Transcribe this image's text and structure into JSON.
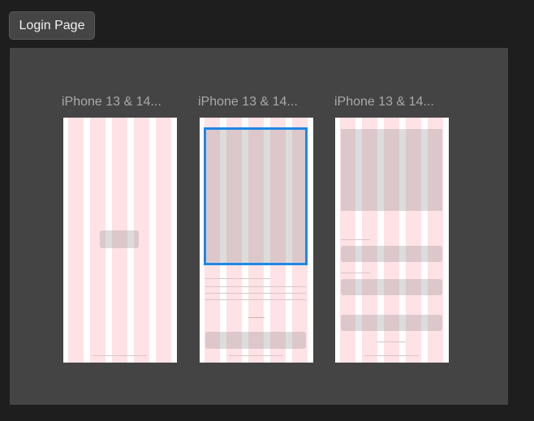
{
  "section": {
    "title": "Login Page"
  },
  "frames": [
    {
      "label": "iPhone 13 & 14..."
    },
    {
      "label": "iPhone 13 & 14..."
    },
    {
      "label": "iPhone 13 & 14..."
    }
  ],
  "colors": {
    "canvas": "#1e1e1e",
    "section_bg": "#444444",
    "frame_bg": "#ffffff",
    "grid_column": "#ffdfe2",
    "selection": "#1e88e5"
  }
}
